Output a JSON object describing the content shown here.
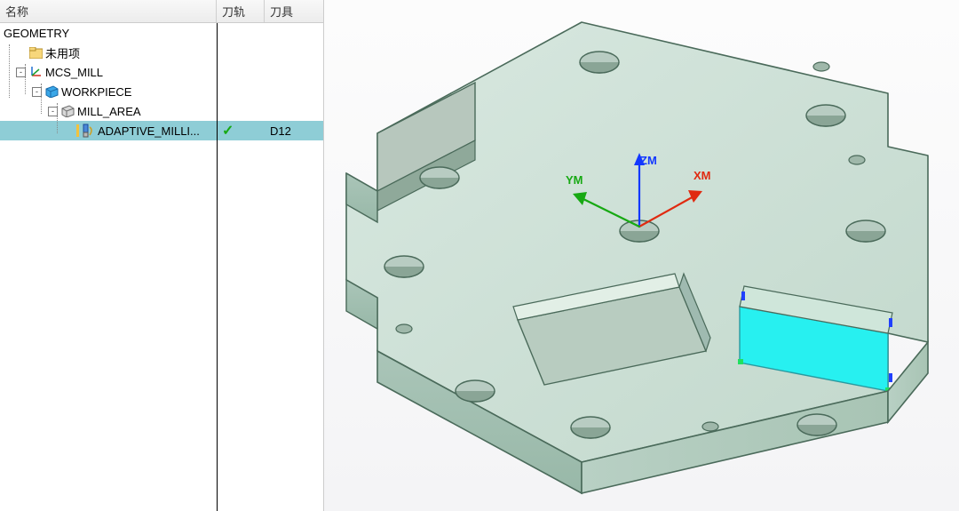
{
  "header": {
    "name_col": "名称",
    "track_col": "刀轨",
    "tool_col": "刀具"
  },
  "tree": {
    "geometry": "GEOMETRY",
    "unused": "未用项",
    "mcs_mill": "MCS_MILL",
    "workpiece": "WORKPIECE",
    "mill_area": "MILL_AREA",
    "adaptive": "ADAPTIVE_MILLI...",
    "adaptive_tool": "D12"
  },
  "axes": {
    "x": "XM",
    "y": "YM",
    "z": "ZM"
  },
  "expanders": {
    "minus": "-"
  }
}
